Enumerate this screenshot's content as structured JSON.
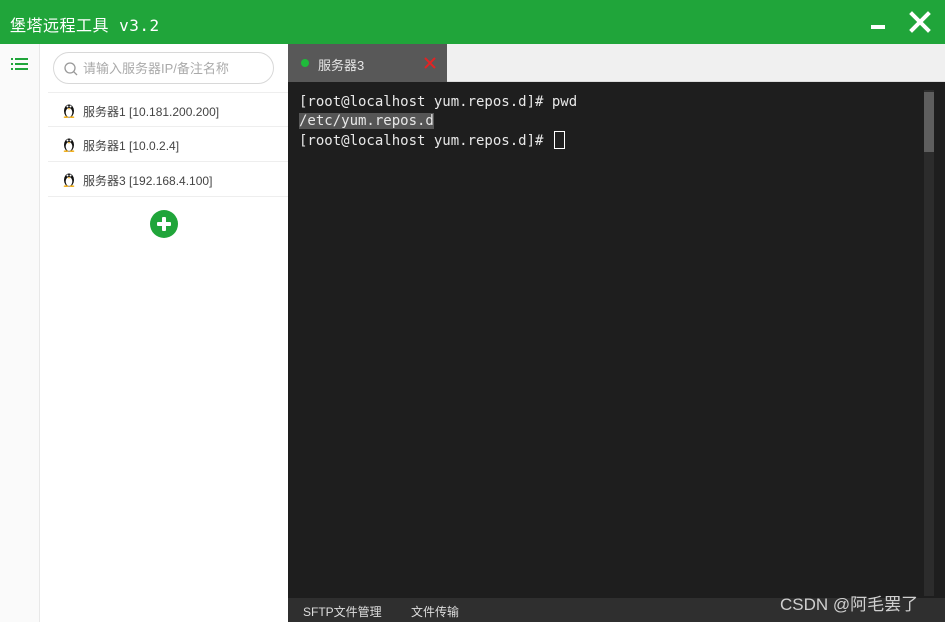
{
  "window": {
    "title": "堡塔远程工具 v3.2"
  },
  "colors": {
    "brand": "#20a53a",
    "terminal_bg": "#1e1e1e",
    "tab_bg": "#585858",
    "close_red": "#e02424"
  },
  "icons": [
    "list-icon",
    "search-icon",
    "penguin-icon",
    "plus-icon",
    "minimize-icon",
    "close-icon"
  ],
  "search": {
    "placeholder": "请输入服务器IP/备注名称",
    "value": ""
  },
  "servers": [
    {
      "label": "服务器1 [10.181.200.200]"
    },
    {
      "label": "服务器1 [10.0.2.4]"
    },
    {
      "label": "服务器3 [192.168.4.100]"
    }
  ],
  "tabs": [
    {
      "label": "服务器3",
      "status": "connected"
    }
  ],
  "terminal": {
    "lines": [
      "[root@localhost yum.repos.d]# pwd",
      "/etc/yum.repos.d",
      "[root@localhost yum.repos.d]# "
    ]
  },
  "bottom_bar": {
    "sftp_label": "SFTP文件管理",
    "transfer_label": "文件传输"
  },
  "watermark": "CSDN @阿毛罢了"
}
